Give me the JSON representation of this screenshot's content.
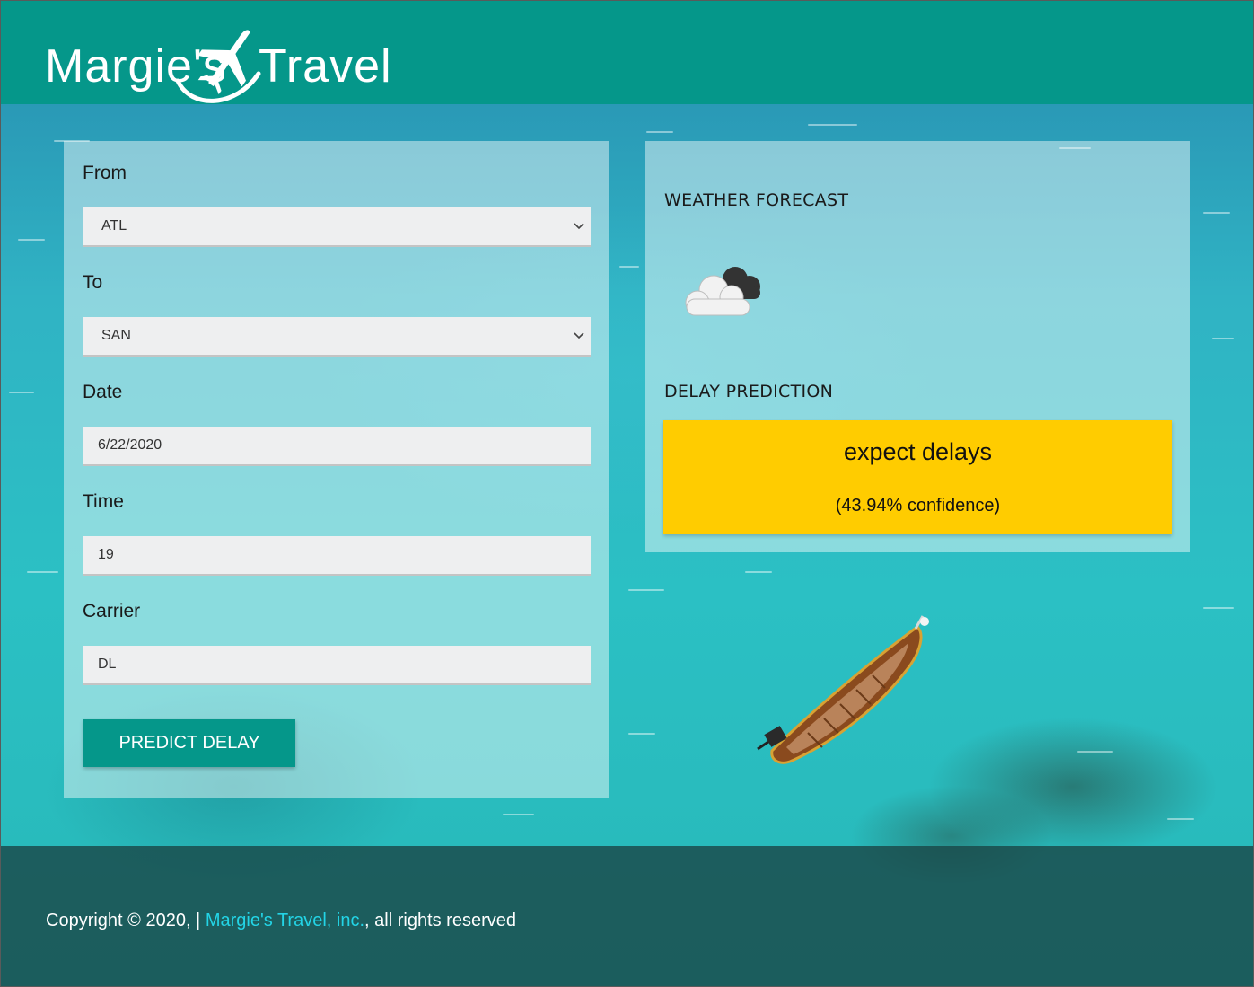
{
  "header": {
    "logo_text_left": "Margie's",
    "logo_text_right": "Travel",
    "brand_color": "#05978a"
  },
  "form": {
    "from": {
      "label": "From",
      "value": "ATL"
    },
    "to": {
      "label": "To",
      "value": "SAN"
    },
    "date": {
      "label": "Date",
      "value": "6/22/2020"
    },
    "time": {
      "label": "Time",
      "value": "19"
    },
    "carrier": {
      "label": "Carrier",
      "value": "DL"
    },
    "submit_label": "PREDICT DELAY"
  },
  "results": {
    "weather_title": "WEATHER FORECAST",
    "weather_icon": "partly-cloudy-icon",
    "delay_title": "DELAY PREDICTION",
    "delay_text": "expect delays",
    "confidence_text": "(43.94% confidence)",
    "delay_box_color": "#ffcc00"
  },
  "footer": {
    "prefix": "Copyright © 2020, | ",
    "link_text": "Margie's Travel, inc.",
    "suffix": ", all rights reserved",
    "link_color": "#23d4e6"
  }
}
